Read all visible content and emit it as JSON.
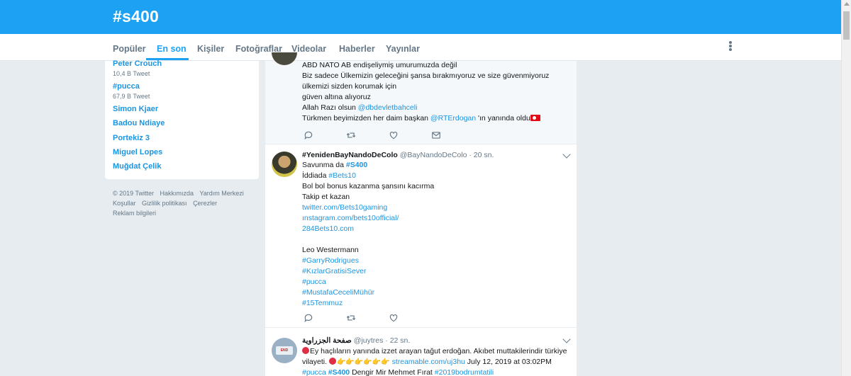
{
  "header": {
    "title": "#s400"
  },
  "tabs": [
    {
      "label": "Popüler",
      "active": false
    },
    {
      "label": "En son",
      "active": true
    },
    {
      "label": "Kişiler",
      "active": false
    },
    {
      "label": "Fotoğraflar",
      "active": false
    },
    {
      "label": "Videolar",
      "active": false
    },
    {
      "label": "Haberler",
      "active": false
    },
    {
      "label": "Yayınlar",
      "active": false
    }
  ],
  "trends": [
    {
      "name": "Peter Crouch",
      "count": "10,4 B Tweet"
    },
    {
      "name": "#pucca",
      "count": "67,9 B Tweet"
    },
    {
      "name": "Simon Kjaer"
    },
    {
      "name": "Badou Ndiaye"
    },
    {
      "name": "Portekiz 3"
    },
    {
      "name": "Miguel Lopes"
    },
    {
      "name": "Muğdat Çelik"
    }
  ],
  "footer": {
    "copyright": "© 2019 Twitter",
    "about": "Hakkımızda",
    "help": "Yardım Merkezi",
    "terms": "Koşullar",
    "privacy": "Gizlilik politikası",
    "cookies": "Çerezler",
    "ads": "Reklam bilgileri"
  },
  "tweets": [
    {
      "lines": [
        "ABD NATO AB endişeliymiş umurumuzda değil",
        "Biz sadece Ülkemizin geleceğini şansa bırakmıyoruz ve size güvenmiyoruz",
        "ülkemizi sizden korumak için",
        "güven altına alıyoruz",
        "Allah Razı olsun ",
        "@dbdevletbahceli",
        "Türkmen beyimizden her daim başkan ",
        "@RTErdogan",
        " 'ın yanında oldu"
      ]
    },
    {
      "name": "#YenidenBayNandoDeColo",
      "handle": "@BayNandoDeColo",
      "time": "· 20 sn.",
      "lines": [
        "Savunma da  ",
        "#S400",
        "İddiada ",
        "#Bets10",
        "Bol bol bonus kazanma şansını kacırma",
        "Takip et kazan",
        "twitter.com/Bets10gaming",
        "ınstagram.com/bets10official/",
        "284Bets10.com",
        "Leo Westermann",
        "#GarryRodrigues",
        "#KızlarGratisiSever",
        "#pucca",
        "#MustafaCeceliMühür",
        "#15Temmuz"
      ]
    },
    {
      "name": "صفحة الجزراوية",
      "handle": "@juytres",
      "time": "· 22 sn.",
      "lines": [
        "Ey haçlıların yanında izzet arayan tağut erdoğan. Akıbet muttakilerindir türkiye",
        "vilayeti. ",
        "streamable.com/uj3hu",
        " July 12, 2019 at 03:02PM",
        "#pucca",
        "#S400",
        " Dengir Mir Mehmet Fırat ",
        "#2019bodrumtatili"
      ],
      "avatar_text": "END"
    }
  ],
  "colors": {
    "brand": "#1da1f2",
    "link": "#1b95e0",
    "muted": "#657786"
  }
}
